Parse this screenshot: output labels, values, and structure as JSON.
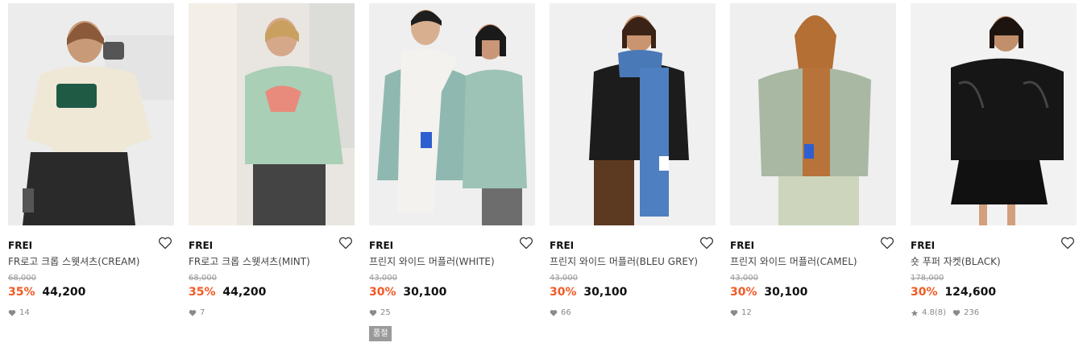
{
  "products": [
    {
      "brand": "FREI",
      "name": "FR로고 크롭 스웻셔츠(CREAM)",
      "original_price": "68,000",
      "discount": "35%",
      "price": "44,200",
      "likes": "14",
      "image": "model-cream-sweatshirt"
    },
    {
      "brand": "FREI",
      "name": "FR로고 크롭 스웻셔츠(MINT)",
      "original_price": "68,000",
      "discount": "35%",
      "price": "44,200",
      "likes": "7",
      "image": "model-mint-sweatshirt"
    },
    {
      "brand": "FREI",
      "name": "프린지 와이드 머플러(WHITE)",
      "original_price": "43,000",
      "discount": "30%",
      "price": "30,100",
      "likes": "25",
      "badge": "품절",
      "image": "models-white-muffler"
    },
    {
      "brand": "FREI",
      "name": "프린지 와이드 머플러(BLEU GREY)",
      "original_price": "43,000",
      "discount": "30%",
      "price": "30,100",
      "likes": "66",
      "image": "model-blue-muffler"
    },
    {
      "brand": "FREI",
      "name": "프린지 와이드 머플러(CAMEL)",
      "original_price": "43,000",
      "discount": "30%",
      "price": "30,100",
      "likes": "12",
      "image": "model-camel-muffler"
    },
    {
      "brand": "FREI",
      "name": "숏 푸퍼 자켓(BLACK)",
      "original_price": "178,000",
      "discount": "30%",
      "price": "124,600",
      "rating": "4.8",
      "reviews": "(8)",
      "likes": "236",
      "image": "model-black-puffer"
    }
  ],
  "colors": {
    "discount": "#f15a24",
    "badge_bg": "#9a9a9a",
    "muted": "#8a8a8a"
  }
}
